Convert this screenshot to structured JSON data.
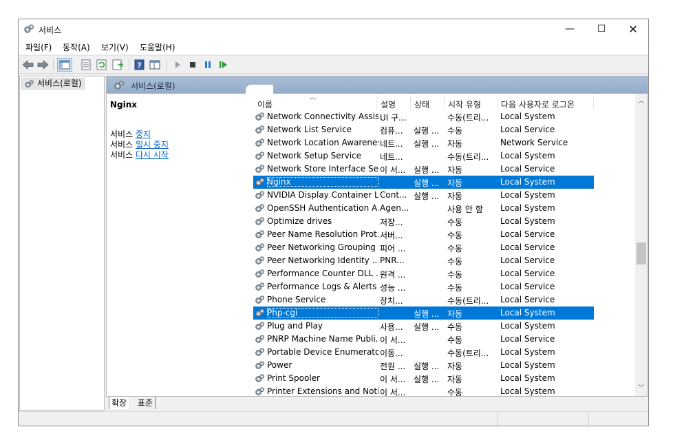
{
  "window": {
    "title": "서비스",
    "min_glyph": "—",
    "max_glyph": "☐",
    "close_glyph": "✕"
  },
  "menu": [
    "파일(F)",
    "동작(A)",
    "보기(V)",
    "도움말(H)"
  ],
  "tree": {
    "root_label": "서비스(로컬)"
  },
  "pane": {
    "title": "서비스(로컬)"
  },
  "detail": {
    "service_name": "Nginx",
    "actions": [
      {
        "prefix": "서비스 ",
        "link": "중지"
      },
      {
        "prefix": "서비스 ",
        "link": "일시 중지"
      },
      {
        "prefix": "서비스 ",
        "link": "다시 시작"
      }
    ]
  },
  "columns": {
    "name": "이름",
    "desc": "설명",
    "status": "상태",
    "start_type": "시작 유형",
    "logon": "다음 사용자로 로그온"
  },
  "services": [
    {
      "name": "Network Connectivity Assis...",
      "desc": "UI 구...",
      "status": "",
      "type": "수동(트리...",
      "logon": "Local System",
      "selected": false
    },
    {
      "name": "Network List Service",
      "desc": "컴퓨...",
      "status": "실행 ...",
      "type": "수동",
      "logon": "Local Service",
      "selected": false
    },
    {
      "name": "Network Location Awareness",
      "desc": "네트...",
      "status": "실행 ...",
      "type": "자동",
      "logon": "Network Service",
      "selected": false
    },
    {
      "name": "Network Setup Service",
      "desc": "네트...",
      "status": "",
      "type": "수동(트리...",
      "logon": "Local System",
      "selected": false
    },
    {
      "name": "Network Store Interface Se...",
      "desc": "이 서...",
      "status": "실행 ...",
      "type": "자동",
      "logon": "Local Service",
      "selected": false
    },
    {
      "name": "Nginx",
      "desc": "",
      "status": "실행 ...",
      "type": "자동",
      "logon": "Local System",
      "selected": true
    },
    {
      "name": "NVIDIA Display Container LS",
      "desc": "Cont...",
      "status": "실행 ...",
      "type": "자동",
      "logon": "Local System",
      "selected": false
    },
    {
      "name": "OpenSSH Authentication A...",
      "desc": "Agen...",
      "status": "",
      "type": "사용 안 함",
      "logon": "Local System",
      "selected": false
    },
    {
      "name": "Optimize drives",
      "desc": "저장...",
      "status": "",
      "type": "수동",
      "logon": "Local System",
      "selected": false
    },
    {
      "name": "Peer Name Resolution Prot...",
      "desc": "서버...",
      "status": "",
      "type": "수동",
      "logon": "Local Service",
      "selected": false
    },
    {
      "name": "Peer Networking Grouping",
      "desc": "피어 ...",
      "status": "",
      "type": "수동",
      "logon": "Local Service",
      "selected": false
    },
    {
      "name": "Peer Networking Identity ...",
      "desc": "PNR...",
      "status": "",
      "type": "수동",
      "logon": "Local Service",
      "selected": false
    },
    {
      "name": "Performance Counter DLL ...",
      "desc": "원격 ...",
      "status": "",
      "type": "수동",
      "logon": "Local Service",
      "selected": false
    },
    {
      "name": "Performance Logs & Alerts",
      "desc": "성능 ...",
      "status": "",
      "type": "수동",
      "logon": "Local Service",
      "selected": false
    },
    {
      "name": "Phone Service",
      "desc": "장치...",
      "status": "",
      "type": "수동(트리...",
      "logon": "Local Service",
      "selected": false
    },
    {
      "name": "Php-cgi",
      "desc": "",
      "status": "실행 ...",
      "type": "자동",
      "logon": "Local System",
      "selected": true
    },
    {
      "name": "Plug and Play",
      "desc": "사용...",
      "status": "실행 ...",
      "type": "수동",
      "logon": "Local System",
      "selected": false
    },
    {
      "name": "PNRP Machine Name Publi...",
      "desc": "이 서...",
      "status": "",
      "type": "수동",
      "logon": "Local Service",
      "selected": false
    },
    {
      "name": "Portable Device Enumerato...",
      "desc": "이동...",
      "status": "",
      "type": "수동(트리...",
      "logon": "Local System",
      "selected": false
    },
    {
      "name": "Power",
      "desc": "전원 ...",
      "status": "실행 ...",
      "type": "자동",
      "logon": "Local System",
      "selected": false
    },
    {
      "name": "Print Spooler",
      "desc": "이 서...",
      "status": "실행 ...",
      "type": "자동",
      "logon": "Local System",
      "selected": false
    },
    {
      "name": "Printer Extensions and Noti...",
      "desc": "이 서...",
      "status": "",
      "type": "수동",
      "logon": "Local System",
      "selected": false
    }
  ],
  "tabs": [
    "확장",
    "표준"
  ],
  "colors": {
    "selection": "#0078d7",
    "header_gradient_top": "#a9bed7",
    "link": "#0066cc"
  }
}
